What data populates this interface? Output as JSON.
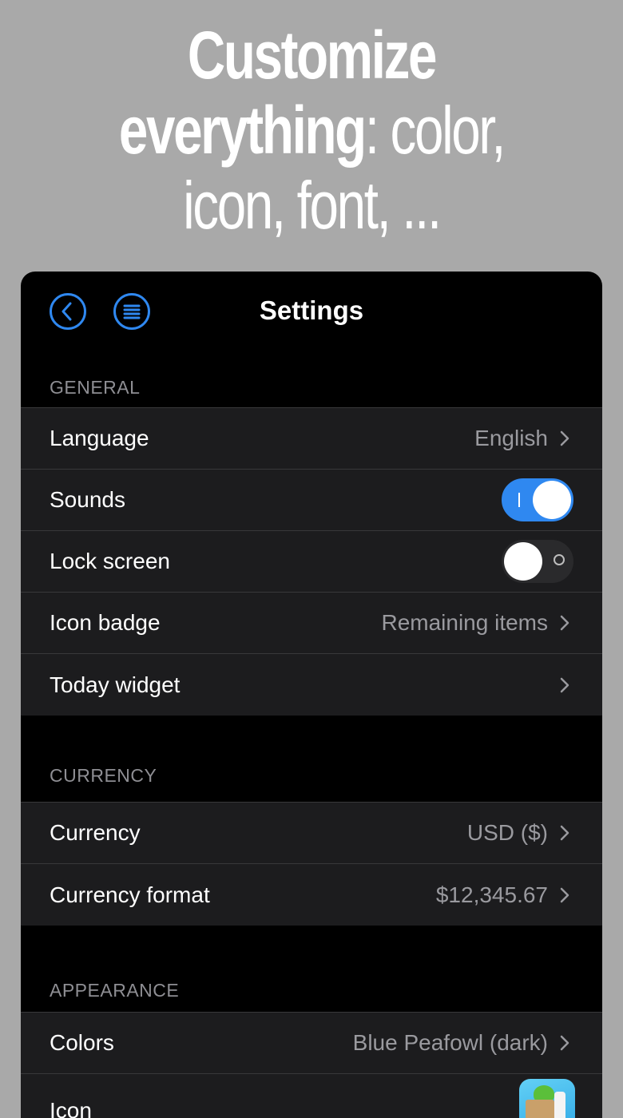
{
  "headline": {
    "line1": "Customize",
    "line2_bold": "everything",
    "line2_rest": ": color,",
    "line3": "icon, font, ..."
  },
  "nav": {
    "title": "Settings",
    "back_icon": "chevron-left-circle-icon",
    "menu_icon": "list-circle-icon"
  },
  "colors": {
    "accent": "#2f88f0",
    "background": "#a9a9a9",
    "row_background": "#1c1c1e",
    "secondary_text": "#9a9a9f"
  },
  "sections": {
    "general": {
      "header": "GENERAL",
      "language": {
        "label": "Language",
        "value": "English"
      },
      "sounds": {
        "label": "Sounds",
        "on": true
      },
      "lock_screen": {
        "label": "Lock screen",
        "on": false
      },
      "icon_badge": {
        "label": "Icon badge",
        "value": "Remaining items"
      },
      "today_widget": {
        "label": "Today widget"
      }
    },
    "currency": {
      "header": "CURRENCY",
      "currency": {
        "label": "Currency",
        "value": "USD ($)"
      },
      "format": {
        "label": "Currency format",
        "value": "$12,345.67"
      }
    },
    "appearance": {
      "header": "APPEARANCE",
      "colors": {
        "label": "Colors",
        "value": "Blue Peafowl (dark)"
      },
      "icon": {
        "label": "Icon"
      }
    }
  }
}
